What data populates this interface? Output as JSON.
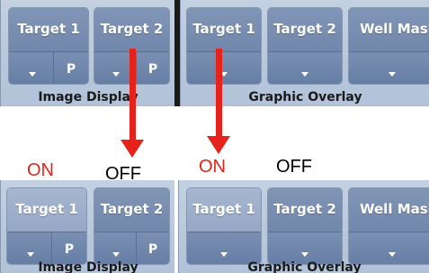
{
  "before": {
    "image_display": {
      "label": "Image Display",
      "targets": [
        {
          "label": "Target 1",
          "caret": "chevron-down-icon",
          "p_label": "P"
        },
        {
          "label": "Target 2",
          "caret": "chevron-down-icon",
          "p_label": "P"
        }
      ]
    },
    "graphic_overlay": {
      "label": "Graphic Overlay",
      "targets": [
        {
          "label": "Target 1",
          "caret": "chevron-down-icon"
        },
        {
          "label": "Target 2",
          "caret": "chevron-down-icon"
        },
        {
          "label": "Well Mask",
          "caret": "chevron-down-icon"
        }
      ]
    }
  },
  "after": {
    "image_display": {
      "label": "Image Display",
      "targets": [
        {
          "label": "Target 1",
          "caret": "chevron-down-icon",
          "p_label": "P",
          "state": "on"
        },
        {
          "label": "Target 2",
          "caret": "chevron-down-icon",
          "p_label": "P",
          "state": "off"
        }
      ]
    },
    "graphic_overlay": {
      "label": "Graphic Overlay",
      "targets": [
        {
          "label": "Target 1",
          "caret": "chevron-down-icon",
          "state": "on"
        },
        {
          "label": "Target 2",
          "caret": "chevron-down-icon",
          "state": "off"
        },
        {
          "label": "Well Mask",
          "caret": "chevron-down-icon"
        }
      ]
    }
  },
  "annotations": {
    "on_label_1": "ON",
    "off_label_1": "OFF",
    "on_label_2": "ON",
    "off_label_2": "OFF",
    "on_color": "#e5231b",
    "off_color": "#000000",
    "arrow_color": "#e5231b"
  }
}
